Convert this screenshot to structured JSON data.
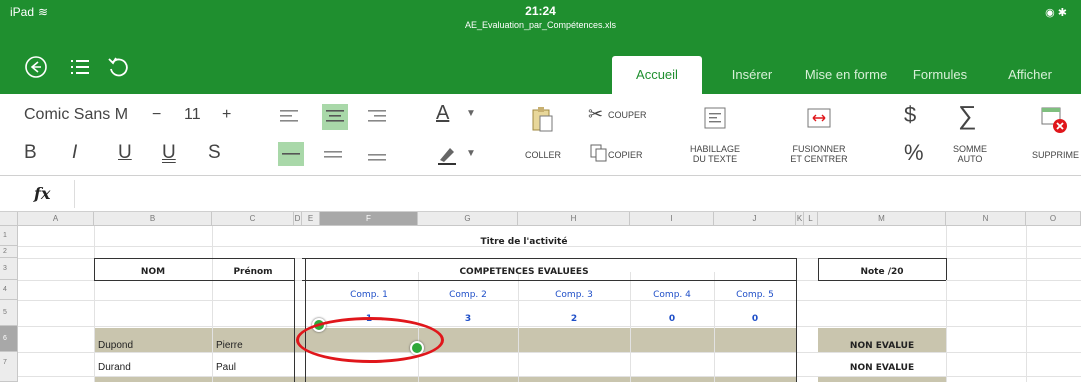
{
  "status": {
    "carrier": "iPad",
    "time": "21:24",
    "filename": "AE_Evaluation_par_Compétences.xls"
  },
  "tabs": [
    "Accueil",
    "Insérer",
    "Mise en forme",
    "Formules",
    "Afficher"
  ],
  "ribbon": {
    "font_name": "Comic Sans M",
    "font_size": "11",
    "minus": "−",
    "plus": "+",
    "bold": "B",
    "italic": "I",
    "underline": "U",
    "double_underline": "U",
    "strike": "S",
    "font_color_letter": "A",
    "paste": "COLLER",
    "cut": "COUPER",
    "copy": "COPIER",
    "wrap_line1": "HABILLAGE",
    "wrap_line2": "DU TEXTE",
    "merge_line1": "FUSIONNER",
    "merge_line2": "ET CENTRER",
    "currency": "$",
    "percent": "%",
    "sum_line1": "SOMME",
    "sum_line2": "AUTO",
    "delete": "SUPPRIME"
  },
  "formula": {
    "label": "fx",
    "value": ""
  },
  "columns": [
    "A",
    "B",
    "C",
    "D",
    "E",
    "F",
    "G",
    "H",
    "I",
    "J",
    "K",
    "L",
    "M",
    "N",
    "O"
  ],
  "rows": [
    "1",
    "2",
    "3",
    "4",
    "5",
    "6",
    "7"
  ],
  "sheet": {
    "title": "Titre de l'activité",
    "nom": "NOM",
    "prenom": "Prénom",
    "competences": "COMPETENCES EVALUEES",
    "note": "Note /20",
    "comp_headers": [
      "Comp. 1",
      "Comp. 2",
      "Comp. 3",
      "Comp. 4",
      "Comp. 5"
    ],
    "coefs": [
      "1",
      "3",
      "2",
      "0",
      "0"
    ],
    "students": [
      {
        "nom": "Dupond",
        "prenom": "Pierre",
        "note": "NON EVALUE"
      },
      {
        "nom": "Durand",
        "prenom": "Paul",
        "note": "NON EVALUE"
      }
    ]
  },
  "colors": {
    "brand_green": "#1f8f2f",
    "highlight_row": "#c9c5ae",
    "annotation_red": "#e0161b",
    "comp_blue": "#1f4fc8"
  }
}
